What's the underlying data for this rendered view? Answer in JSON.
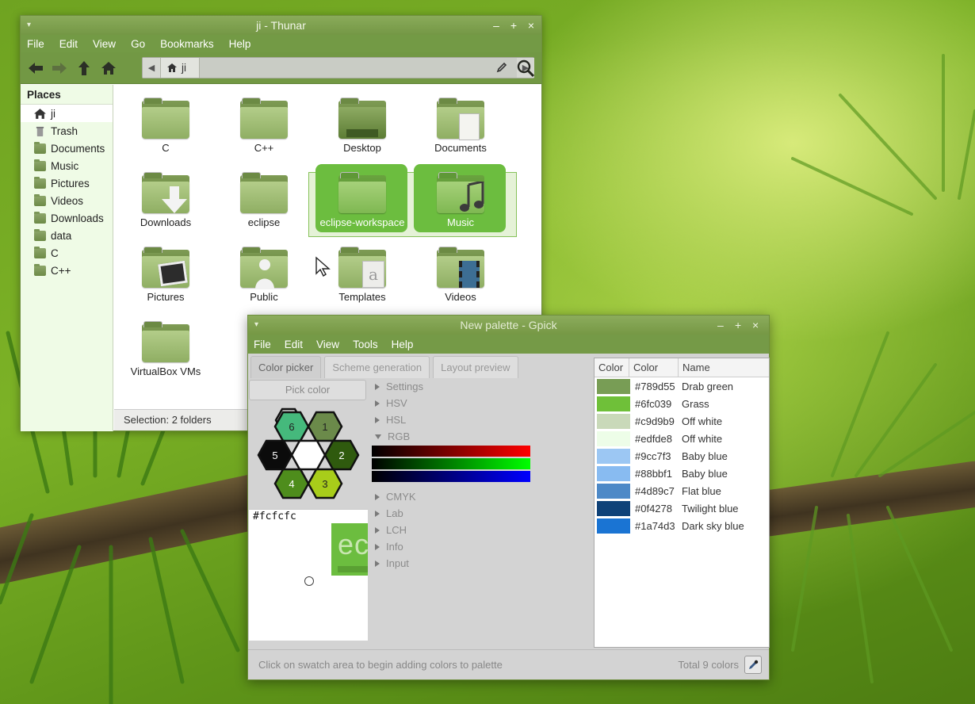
{
  "thunar": {
    "title": "ji - Thunar",
    "menu": [
      "File",
      "Edit",
      "View",
      "Go",
      "Bookmarks",
      "Help"
    ],
    "path_crumb": "ji",
    "places_header": "Places",
    "places": [
      "ji",
      "Trash",
      "Documents",
      "Music",
      "Pictures",
      "Videos",
      "Downloads",
      "data",
      "C",
      "C++"
    ],
    "files": [
      "C",
      "C++",
      "Desktop",
      "Documents",
      "Downloads",
      "eclipse",
      "eclipse-workspace",
      "Music",
      "Pictures",
      "Public",
      "Templates",
      "Videos",
      "VirtualBox VMs"
    ],
    "status": "Selection: 2 folders"
  },
  "gpick": {
    "title": "New palette - Gpick",
    "menu": [
      "File",
      "Edit",
      "View",
      "Tools",
      "Help"
    ],
    "tabs": [
      "Color picker",
      "Scheme generation",
      "Layout preview"
    ],
    "pick_button": "Pick color",
    "hex_numbers": [
      "6",
      "1",
      "5",
      "2",
      "4",
      "3"
    ],
    "current_hex": "#fcfcfc",
    "zoom_text": "ec",
    "sections_top": [
      "Settings",
      "HSV",
      "HSL"
    ],
    "rgb_label": "RGB",
    "rgb_values": [
      "0",
      "0",
      "0"
    ],
    "sections_bottom": [
      "CMYK",
      "Lab",
      "LCH",
      "Info",
      "Input"
    ],
    "palette_headers": [
      "Color",
      "Color",
      "Name"
    ],
    "palette": [
      {
        "hex": "#789d55",
        "name": "Drab green",
        "color": "#789d55"
      },
      {
        "hex": "#6fc039",
        "name": "Grass",
        "color": "#6fc039"
      },
      {
        "hex": "#c9d9b9",
        "name": "Off white",
        "color": "#c9d9b9"
      },
      {
        "hex": "#edfde8",
        "name": "Off white",
        "color": "#edfde8"
      },
      {
        "hex": "#9cc7f3",
        "name": "Baby blue",
        "color": "#9cc7f3"
      },
      {
        "hex": "#88bbf1",
        "name": "Baby blue",
        "color": "#88bbf1"
      },
      {
        "hex": "#4d89c7",
        "name": "Flat blue",
        "color": "#4d89c7"
      },
      {
        "hex": "#0f4278",
        "name": "Twilight blue",
        "color": "#0f4278"
      },
      {
        "hex": "#1a74d3",
        "name": "Dark sky blue",
        "color": "#1a74d3"
      }
    ],
    "status_left": "Click on swatch area to begin adding colors to palette",
    "status_right": "Total 9 colors"
  }
}
